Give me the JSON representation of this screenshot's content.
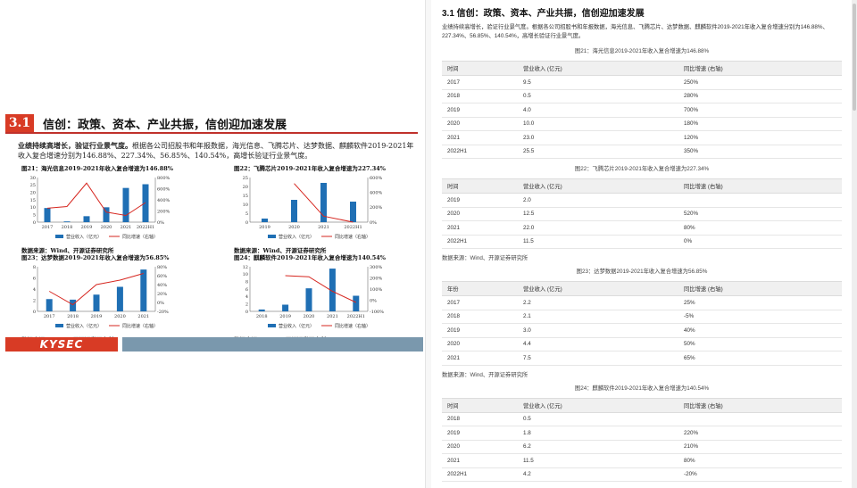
{
  "report": {
    "section_number": "3.1",
    "section_title": "信创：政策、资本、产业共振，信创迎加速发展",
    "lead_bold": "业绩持续高增长，验证行业景气度。",
    "lead_rest": "根据各公司招股书和年报数据，海光信息、飞腾芯片、达梦数据、麒麟软件2019-2021年收入复合增速分别为146.88%、227.34%、56.85%、140.54%，高增长验证行业景气度。",
    "legend_revenue": "营业收入（亿元）",
    "legend_growth": "同比增速（右轴）",
    "source_note": "数据来源：Wind、开源证券研究所",
    "footer_logo": "KYSEC",
    "brand_red": "#d83b25",
    "brand_blue": "#7a98ad",
    "bar_color": "#1f6fb4",
    "line_color": "#d6261f"
  },
  "chart_data": [
    {
      "type": "bar",
      "title": "图21：海光信息2019-2021年收入复合增速为146.88%",
      "categories": [
        "2017",
        "2018",
        "2019",
        "2020",
        "2021",
        "2022H1"
      ],
      "series": [
        {
          "name": "营业收入（亿元）",
          "axis": "left",
          "values": [
            9.5,
            0.5,
            4.0,
            10.0,
            23.0,
            25.5
          ]
        },
        {
          "name": "同比增速（右轴）",
          "axis": "right",
          "type": "line",
          "values": [
            250,
            280,
            700,
            180,
            120,
            350
          ]
        }
      ],
      "ylim": [
        0,
        30
      ],
      "yticks": [
        "0",
        "5",
        "10",
        "15",
        "20",
        "25",
        "30"
      ],
      "y2lim": [
        0,
        800
      ],
      "y2ticks": [
        "0%",
        "200%",
        "400%",
        "600%",
        "800%"
      ]
    },
    {
      "type": "bar",
      "title": "图22：飞腾芯片2019-2021年收入复合增速为227.34%",
      "categories": [
        "2019",
        "2020",
        "2021",
        "2022H1"
      ],
      "series": [
        {
          "name": "营业收入（亿元）",
          "axis": "left",
          "values": [
            2.0,
            12.5,
            22.0,
            11.5
          ]
        },
        {
          "name": "同比增速（右轴）",
          "axis": "right",
          "type": "line",
          "values": [
            null,
            520,
            80,
            0
          ]
        }
      ],
      "ylim": [
        0,
        25
      ],
      "yticks": [
        "0",
        "5",
        "10",
        "15",
        "20",
        "25"
      ],
      "y2lim": [
        0,
        600
      ],
      "y2ticks": [
        "0%",
        "200%",
        "400%",
        "600%"
      ]
    },
    {
      "type": "bar",
      "title": "图23：达梦数据2019-2021年收入复合增速为56.85%",
      "categories": [
        "2017",
        "2018",
        "2019",
        "2020",
        "2021"
      ],
      "series": [
        {
          "name": "营业收入（亿元）",
          "axis": "left",
          "values": [
            2.2,
            2.1,
            3.0,
            4.4,
            7.5
          ]
        },
        {
          "name": "同比增速（右轴）",
          "axis": "right",
          "type": "line",
          "values": [
            25,
            -5,
            40,
            50,
            65
          ]
        }
      ],
      "ylim": [
        0,
        8
      ],
      "yticks": [
        "0",
        "2",
        "4",
        "6",
        "8"
      ],
      "y2lim": [
        -20,
        80
      ],
      "y2ticks": [
        "-20%",
        "0%",
        "20%",
        "40%",
        "60%",
        "80%"
      ]
    },
    {
      "type": "bar",
      "title": "图24：麒麟软件2019-2021年收入复合增速为140.54%",
      "categories": [
        "2018",
        "2019",
        "2020",
        "2021",
        "2022H1"
      ],
      "series": [
        {
          "name": "营业收入（亿元）",
          "axis": "left",
          "values": [
            0.5,
            1.8,
            6.2,
            11.5,
            4.2
          ]
        },
        {
          "name": "同比增速（右轴）",
          "axis": "right",
          "type": "line",
          "values": [
            null,
            220,
            210,
            80,
            -20
          ]
        }
      ],
      "ylim": [
        0,
        12
      ],
      "yticks": [
        "0",
        "2",
        "4",
        "6",
        "8",
        "10",
        "12"
      ],
      "y2lim": [
        -100,
        300
      ],
      "y2ticks": [
        "-100%",
        "0%",
        "100%",
        "200%",
        "300%"
      ]
    }
  ],
  "transcript": {
    "heading": "3.1 信创：政策、资本、产业共振，信创迎加速发展",
    "para": "业绩持续高增长，验证行业景气度。根据各公司招股书和年报数据，海光信息、飞腾芯片、达梦数据、麒麟软件2019-2021年收入复合增速分别为146.88%、227.34%、56.85%、140.54%，高增长验证行业景气度。",
    "source": "数据来源：Wind、开源证券研究所",
    "tables": [
      {
        "caption": "图21：海光信息2019-2021年收入复合增速为146.88%",
        "headers": [
          "时间",
          "营业收入 (亿元)",
          "同比增速 (右轴)"
        ],
        "rows": [
          [
            "2017",
            "9.5",
            "250%"
          ],
          [
            "2018",
            "0.5",
            "280%"
          ],
          [
            "2019",
            "4.0",
            "700%"
          ],
          [
            "2020",
            "10.0",
            "180%"
          ],
          [
            "2021",
            "23.0",
            "120%"
          ],
          [
            "2022H1",
            "25.5",
            "350%"
          ]
        ]
      },
      {
        "caption": "图22：飞腾芯片2019-2021年收入复合增速为227.34%",
        "headers": [
          "时间",
          "营业收入 (亿元)",
          "同比增速 (右轴)"
        ],
        "rows": [
          [
            "2019",
            "2.0",
            ""
          ],
          [
            "2020",
            "12.5",
            "520%"
          ],
          [
            "2021",
            "22.0",
            "80%"
          ],
          [
            "2022H1",
            "11.5",
            "0%"
          ]
        ]
      },
      {
        "caption": "图23：达梦数据2019-2021年收入复合增速为56.85%",
        "headers": [
          "年份",
          "营业收入 (亿元)",
          "同比增速 (右轴)"
        ],
        "rows": [
          [
            "2017",
            "2.2",
            "25%"
          ],
          [
            "2018",
            "2.1",
            "-5%"
          ],
          [
            "2019",
            "3.0",
            "40%"
          ],
          [
            "2020",
            "4.4",
            "50%"
          ],
          [
            "2021",
            "7.5",
            "65%"
          ]
        ]
      },
      {
        "caption": "图24：麒麟软件2019-2021年收入复合增速为140.54%",
        "headers": [
          "时间",
          "营业收入 (亿元)",
          "同比增速 (右轴)"
        ],
        "rows": [
          [
            "2018",
            "0.5",
            ""
          ],
          [
            "2019",
            "1.8",
            "220%"
          ],
          [
            "2020",
            "6.2",
            "210%"
          ],
          [
            "2021",
            "11.5",
            "80%"
          ],
          [
            "2022H1",
            "4.2",
            "-20%"
          ]
        ]
      }
    ]
  }
}
